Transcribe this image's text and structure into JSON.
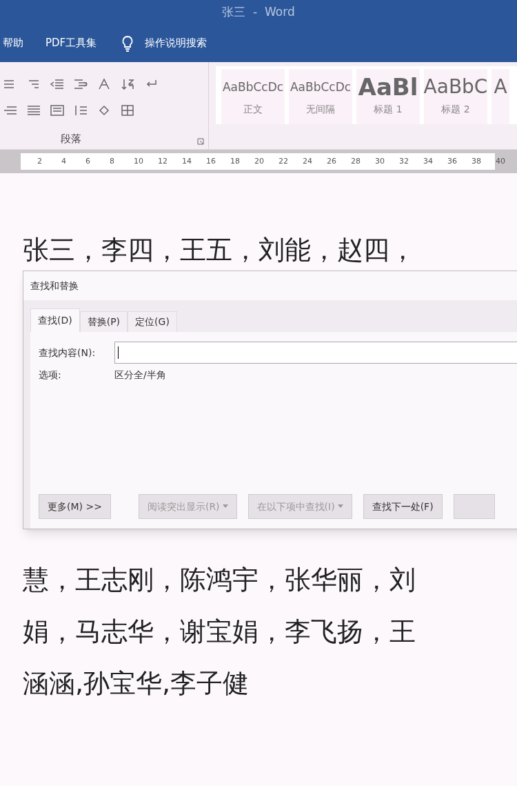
{
  "window": {
    "title": "张三  -  Word"
  },
  "menu": [
    {
      "label": "帮助",
      "kind": "text"
    },
    {
      "label": "PDF工具集",
      "kind": "text"
    },
    {
      "label": "操作说明搜索",
      "kind": "search"
    }
  ],
  "ribbon": {
    "group_label": "段落",
    "styles": [
      {
        "sample": "AaBbCcDc",
        "name": "正文",
        "kind": "body"
      },
      {
        "sample": "AaBbCcDc",
        "name": "无间隔",
        "kind": "body"
      },
      {
        "sample": "AaBl",
        "name": "标题 1",
        "kind": "h1"
      },
      {
        "sample": "AaBbC",
        "name": "标题 2",
        "kind": "h2"
      },
      {
        "sample": "A",
        "kind": "cut"
      }
    ]
  },
  "ruler": {
    "ticks": [
      "2",
      "4",
      "6",
      "8",
      "10",
      "12",
      "14",
      "16",
      "18",
      "20",
      "22",
      "24",
      "26",
      "28",
      "30",
      "32",
      "34",
      "36",
      "38",
      "40"
    ]
  },
  "document": {
    "lines_before": [
      "张三，李四，王五，刘能，赵四，"
    ],
    "lines_after": [
      "慧，王志刚，陈鸿宇，张华丽，刘",
      "娟，马志华，谢宝娟，李飞扬，王",
      "涵涵,孙宝华,李子健"
    ]
  },
  "dialog": {
    "title": "查找和替换",
    "tabs": [
      {
        "label": "查找(D)",
        "selected": true
      },
      {
        "label": "替换(P)",
        "selected": false
      },
      {
        "label": "定位(G)",
        "selected": false
      }
    ],
    "find_label": "查找内容(N):",
    "options_label": "选项:",
    "options_value": "区分全/半角",
    "buttons": [
      {
        "label": "更多(M) >>",
        "disabled": false,
        "dropdown": false
      },
      {
        "label": "阅读突出显示(R)",
        "disabled": true,
        "dropdown": true
      },
      {
        "label": "在以下项中查找(I)",
        "disabled": true,
        "dropdown": true
      },
      {
        "label": "查找下一处(F)",
        "disabled": false,
        "dropdown": false
      }
    ]
  }
}
